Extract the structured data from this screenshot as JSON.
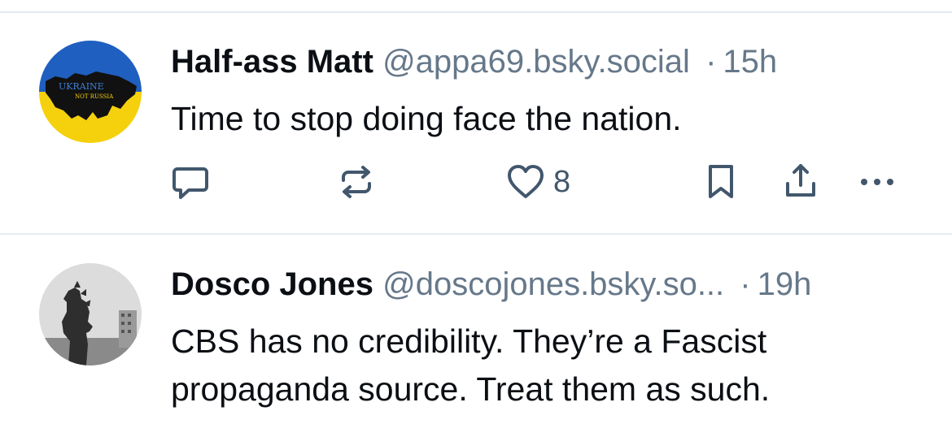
{
  "posts": [
    {
      "author_name": "Half-ass Matt",
      "handle": "@appa69.bsky.social",
      "separator": "·",
      "time": "15h",
      "text": "Time to stop doing face the nation.",
      "avatar_text_1": "UKRAINE",
      "avatar_text_2": "NOT RUSSIA",
      "like_count": "8",
      "icons": [
        "reply-icon",
        "repost-icon",
        "like-icon",
        "bookmark-icon",
        "share-icon",
        "more-icon"
      ]
    },
    {
      "author_name": "Dosco Jones",
      "handle": "@doscojones.bsky.so...",
      "separator": "·",
      "time": "19h",
      "text": "CBS has no credibility.  They’re a Fascist propaganda source.  Treat them as such."
    }
  ],
  "colors": {
    "text": "#0b0f14",
    "muted": "#66788a",
    "icon": "#42576c",
    "divider": "#e7ebef",
    "ukraine_blue": "#1f5fbf",
    "ukraine_yellow": "#f5d00d"
  }
}
